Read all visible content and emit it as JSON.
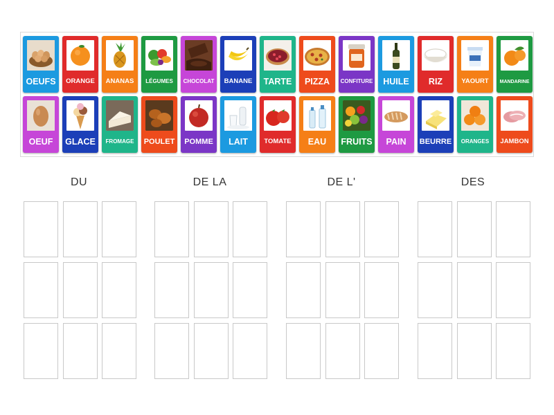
{
  "colors": {
    "blue": "#1c9ae0",
    "red": "#e02b2b",
    "orange": "#f57f17",
    "green": "#1e9a42",
    "magenta": "#c646d8",
    "navy": "#1c3fb8",
    "teal": "#1fb58a",
    "orange_red": "#ee4b1c",
    "purple": "#7b36c6"
  },
  "cards": [
    {
      "label": "OEUFS",
      "color": "#1c9ae0",
      "icon": "basket-of-eggs-icon",
      "size": "fs-l"
    },
    {
      "label": "ORANGE",
      "color": "#e02b2b",
      "icon": "orange-icon",
      "size": "fs-s"
    },
    {
      "label": "ANANAS",
      "color": "#f57f17",
      "icon": "pineapple-icon",
      "size": "fs-s"
    },
    {
      "label": "LÉGUMES",
      "color": "#1e9a42",
      "icon": "vegetables-icon",
      "size": "fs-xs"
    },
    {
      "label": "CHOCOLAT",
      "color": "#c646d8",
      "icon": "chocolate-icon",
      "size": "fs-xs"
    },
    {
      "label": "BANANE",
      "color": "#1c3fb8",
      "icon": "bananas-icon",
      "size": "fs-s"
    },
    {
      "label": "TARTE",
      "color": "#1fb58a",
      "icon": "tart-icon",
      "size": "fs-l"
    },
    {
      "label": "PIZZA",
      "color": "#ee4b1c",
      "icon": "pizza-icon",
      "size": "fs-l"
    },
    {
      "label": "CONFITURE",
      "color": "#7b36c6",
      "icon": "jam-jar-icon",
      "size": "fs-xs"
    },
    {
      "label": "HUILE",
      "color": "#1c9ae0",
      "icon": "oil-bottle-icon",
      "size": "fs-l"
    },
    {
      "label": "RIZ",
      "color": "#e02b2b",
      "icon": "rice-bowl-icon",
      "size": "fs-l"
    },
    {
      "label": "YAOURT",
      "color": "#f57f17",
      "icon": "yogurt-icon",
      "size": "fs-s"
    },
    {
      "label": "MANDARINE",
      "color": "#1e9a42",
      "icon": "mandarin-icon",
      "size": "fs-xxs"
    },
    {
      "label": "OEUF",
      "color": "#c646d8",
      "icon": "egg-icon",
      "size": "fs-l"
    },
    {
      "label": "GLACE",
      "color": "#1c3fb8",
      "icon": "ice-cream-icon",
      "size": "fs-l"
    },
    {
      "label": "FROMAGE",
      "color": "#1fb58a",
      "icon": "cheese-icon",
      "size": "fs-xs"
    },
    {
      "label": "POULET",
      "color": "#ee4b1c",
      "icon": "chicken-icon",
      "size": "fs-m"
    },
    {
      "label": "POMME",
      "color": "#7b36c6",
      "icon": "apple-icon",
      "size": "fs-m"
    },
    {
      "label": "LAIT",
      "color": "#1c9ae0",
      "icon": "milk-icon",
      "size": "fs-l"
    },
    {
      "label": "TOMATE",
      "color": "#e02b2b",
      "icon": "tomato-icon",
      "size": "fs-s"
    },
    {
      "label": "EAU",
      "color": "#f57f17",
      "icon": "water-bottles-icon",
      "size": "fs-l"
    },
    {
      "label": "FRUITS",
      "color": "#1e9a42",
      "icon": "fruits-icon",
      "size": "fs-l"
    },
    {
      "label": "PAIN",
      "color": "#c646d8",
      "icon": "bread-icon",
      "size": "fs-l"
    },
    {
      "label": "BEURRE",
      "color": "#1c3fb8",
      "icon": "butter-icon",
      "size": "fs-m"
    },
    {
      "label": "ORANGES",
      "color": "#1fb58a",
      "icon": "oranges-icon",
      "size": "fs-xs"
    },
    {
      "label": "JAMBON",
      "color": "#ee4b1c",
      "icon": "ham-icon",
      "size": "fs-s"
    }
  ],
  "groups": [
    {
      "title": "DU"
    },
    {
      "title": "DE LA"
    },
    {
      "title": "DE L'"
    },
    {
      "title": "DES"
    }
  ]
}
